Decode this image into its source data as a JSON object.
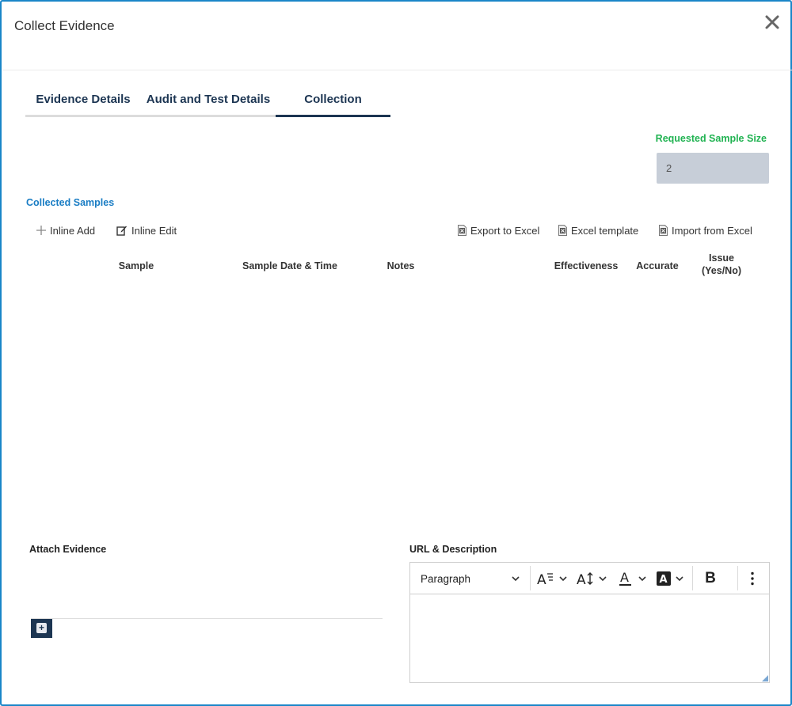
{
  "dialog": {
    "title": "Collect Evidence"
  },
  "tabs": [
    {
      "label": "Evidence Details",
      "active": false
    },
    {
      "label": "Audit and Test Details",
      "active": false
    },
    {
      "label": "Collection",
      "active": true
    }
  ],
  "requested_sample": {
    "label": "Requested Sample Size",
    "value": "2"
  },
  "collected_samples": {
    "label": "Collected Samples",
    "toolbar": {
      "inline_add": "Inline Add",
      "inline_edit": "Inline Edit",
      "export_to_excel": "Export to Excel",
      "excel_template": "Excel template",
      "import_from_excel": "Import from Excel"
    },
    "columns": [
      "Sample",
      "Sample Date & Time",
      "Notes",
      "Effectiveness",
      "Accurate",
      "Issue",
      "(Yes/No)"
    ],
    "rows": []
  },
  "attach_evidence": {
    "label": "Attach Evidence"
  },
  "url_description": {
    "label": "URL & Description",
    "editor": {
      "block_format": "Paragraph",
      "bold_label": "B",
      "content": ""
    }
  },
  "colors": {
    "border_accent": "#1a86c8",
    "tab_text": "#1c3552",
    "required_green": "#21b352",
    "section_blue": "#1a7dc4",
    "sample_box": "#c7ced8"
  },
  "icons": {
    "close": "close-icon",
    "inline_add": "plus-icon",
    "inline_edit": "edit-icon",
    "excel": "excel-file-icon",
    "chevron": "chevron-down-icon",
    "font_family": "font-family-icon",
    "font_size": "font-size-icon",
    "font_color": "font-color-icon",
    "highlight": "highlight-color-icon",
    "more": "more-vertical-icon"
  }
}
